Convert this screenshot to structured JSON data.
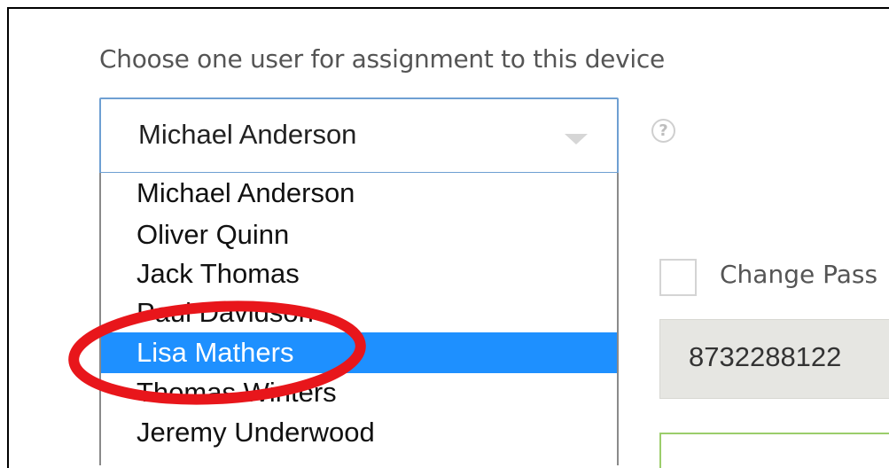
{
  "prompt": "Choose one user for assignment to this device",
  "select": {
    "value": "Michael Anderson",
    "options": [
      "Michael Anderson",
      "Oliver Quinn",
      "Jack Thomas",
      "Paul Davidson",
      "Lisa Mathers",
      "Thomas Winters",
      "Jeremy Underwood"
    ],
    "selected_index": 4
  },
  "help_icon": {
    "glyph": "?",
    "icon": "question-circle-icon"
  },
  "change_password": {
    "label": "Change Pass"
  },
  "phone": {
    "value": "8732288122"
  },
  "colors": {
    "selected_bg": "#1e90ff",
    "select_border": "#6e9fd2",
    "annotation": "#e8161b",
    "phone_bg": "#e6e6e2",
    "green_border": "#9bcd6b"
  }
}
